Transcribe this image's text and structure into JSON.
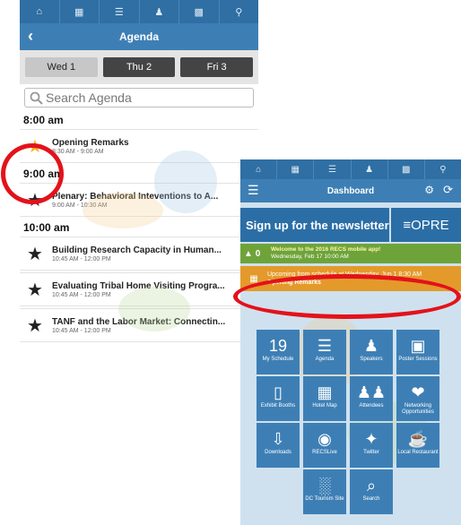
{
  "agenda": {
    "nav_icons": [
      "home-icon",
      "calendar-icon",
      "list-icon",
      "person-icon",
      "booth-icon",
      "search-icon"
    ],
    "title": "Agenda",
    "days": [
      {
        "label": "Wed 1",
        "selected": true
      },
      {
        "label": "Thu 2",
        "selected": false
      },
      {
        "label": "Fri 3",
        "selected": false
      }
    ],
    "search_placeholder": "Search Agenda",
    "groups": [
      {
        "time": "8:00 am",
        "sessions": [
          {
            "title": "Opening Remarks",
            "time": "8:30 AM - 9:00 AM",
            "favorite": true
          }
        ]
      },
      {
        "time": "9:00 am",
        "sessions": [
          {
            "title": "Plenary: Behavioral Inteventions to A...",
            "time": "9:00 AM - 10:30 AM",
            "favorite": false
          }
        ]
      },
      {
        "time": "10:00 am",
        "sessions": [
          {
            "title": "Building Research Capacity in Human...",
            "time": "10:45 AM - 12:00 PM",
            "favorite": false
          },
          {
            "title": "Evaluating Tribal Home Visiting Progra...",
            "time": "10:45 AM - 12:00 PM",
            "favorite": false
          },
          {
            "title": "TANF and the Labor Market: Connectin...",
            "time": "10:45 AM - 12:00 PM",
            "favorite": false
          }
        ]
      }
    ]
  },
  "dashboard": {
    "title": "Dashboard",
    "newsletter": "Sign up for the newsletter",
    "logo_text": "≡OPRE",
    "alert_count": "0",
    "alert_line1": "Welcome to the 2016 RECS mobile app!",
    "alert_line2": "Wednesday, Feb 17 10:00 AM",
    "upnext_line1": "Upcoming from schedule at Wednesday, Jun 1 8:30 AM",
    "upnext_line2": "Opening Remarks",
    "tiles": [
      {
        "label": "My Schedule",
        "icon": "calendar-icon",
        "glyph": "19"
      },
      {
        "label": "Agenda",
        "icon": "list-icon",
        "glyph": "☰"
      },
      {
        "label": "Speakers",
        "icon": "speaker-icon",
        "glyph": "♟"
      },
      {
        "label": "Poster Sessions",
        "icon": "easel-icon",
        "glyph": "▣"
      },
      {
        "label": "Exhibit Booths",
        "icon": "booth-icon",
        "glyph": "▯"
      },
      {
        "label": "Hotel Map",
        "icon": "map-grid-icon",
        "glyph": "▦"
      },
      {
        "label": "Attendees",
        "icon": "people-icon",
        "glyph": "♟♟"
      },
      {
        "label": "Networking Opportunities",
        "icon": "handshake-icon",
        "glyph": "❤"
      },
      {
        "label": "Downloads",
        "icon": "download-icon",
        "glyph": "⇩"
      },
      {
        "label": "RECSLive",
        "icon": "broadcast-icon",
        "glyph": "◉"
      },
      {
        "label": "Twitter",
        "icon": "twitter-icon",
        "glyph": "✦"
      },
      {
        "label": "Local Restaurant",
        "icon": "drink-icon",
        "glyph": "☕"
      },
      {
        "label": "DC Tourism Site",
        "icon": "landmark-icon",
        "glyph": "░"
      },
      {
        "label": "Search",
        "icon": "search-icon",
        "glyph": "⌕"
      }
    ]
  },
  "colors": {
    "nav_blue": "#2f6fa3",
    "title_blue": "#3d7fb5",
    "favorite_star": "#f4b41a",
    "alert_green": "#6ea33a",
    "upnext_orange": "#e49a2a",
    "annotation_red": "#e3121b"
  }
}
